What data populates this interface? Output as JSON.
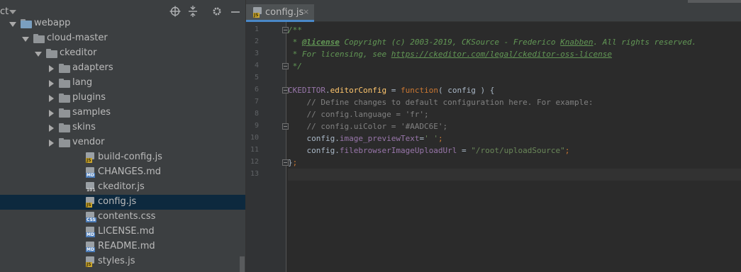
{
  "project": {
    "title": "ct",
    "tree": [
      {
        "label": "webapp",
        "indent": 0,
        "kind": "module",
        "expanded": true
      },
      {
        "label": "cloud-master",
        "indent": 1,
        "kind": "folder",
        "expanded": true
      },
      {
        "label": "ckeditor",
        "indent": 2,
        "kind": "folder",
        "expanded": true
      },
      {
        "label": "adapters",
        "indent": 3,
        "kind": "folder",
        "expanded": false
      },
      {
        "label": "lang",
        "indent": 3,
        "kind": "folder",
        "expanded": false
      },
      {
        "label": "plugins",
        "indent": 3,
        "kind": "folder",
        "expanded": false
      },
      {
        "label": "samples",
        "indent": 3,
        "kind": "folder",
        "expanded": false
      },
      {
        "label": "skins",
        "indent": 3,
        "kind": "folder",
        "expanded": false
      },
      {
        "label": "vendor",
        "indent": 3,
        "kind": "folder",
        "expanded": false
      },
      {
        "label": "build-config.js",
        "indent": 3,
        "kind": "js"
      },
      {
        "label": "CHANGES.md",
        "indent": 3,
        "kind": "md"
      },
      {
        "label": "ckeditor.js",
        "indent": 3,
        "kind": "bin"
      },
      {
        "label": "config.js",
        "indent": 3,
        "kind": "js",
        "selected": true
      },
      {
        "label": "contents.css",
        "indent": 3,
        "kind": "css"
      },
      {
        "label": "LICENSE.md",
        "indent": 3,
        "kind": "md"
      },
      {
        "label": "README.md",
        "indent": 3,
        "kind": "md"
      },
      {
        "label": "styles.js",
        "indent": 3,
        "kind": "js"
      }
    ]
  },
  "icons": {
    "file_tags": {
      "js": "JS",
      "md": "MD",
      "css": "CSS",
      "bin": "101"
    },
    "header": [
      "locate-icon",
      "collapse-icon",
      "settings-icon",
      "hide-icon"
    ]
  },
  "editor": {
    "tab": {
      "label": "config.js",
      "close": "×"
    },
    "line_numbers": [
      "1",
      "2",
      "3",
      "4",
      "5",
      "6",
      "7",
      "8",
      "9",
      "10",
      "11",
      "12",
      "13"
    ],
    "lines": [
      "/**",
      " * @license Copyright (c) 2003-2019, CKSource - Frederico Knabben. All rights reserved.",
      " * For licensing, see https://ckeditor.com/legal/ckeditor-oss-license",
      " */",
      "",
      "CKEDITOR.editorConfig = function( config ) {",
      "    // Define changes to default configuration here. For example:",
      "    // config.language = 'fr';",
      "    // config.uiColor = '#AADC6E';",
      "    config.image_previewText=' ';",
      "    config.filebrowserImageUploadUrl = \"/root/uploadSource\";",
      "};",
      ""
    ]
  },
  "colors": {
    "panel_bg": "#3c3f41",
    "editor_bg": "#2b2b2b",
    "selection": "#0d293e",
    "tab_underline": "#4a88c7"
  }
}
